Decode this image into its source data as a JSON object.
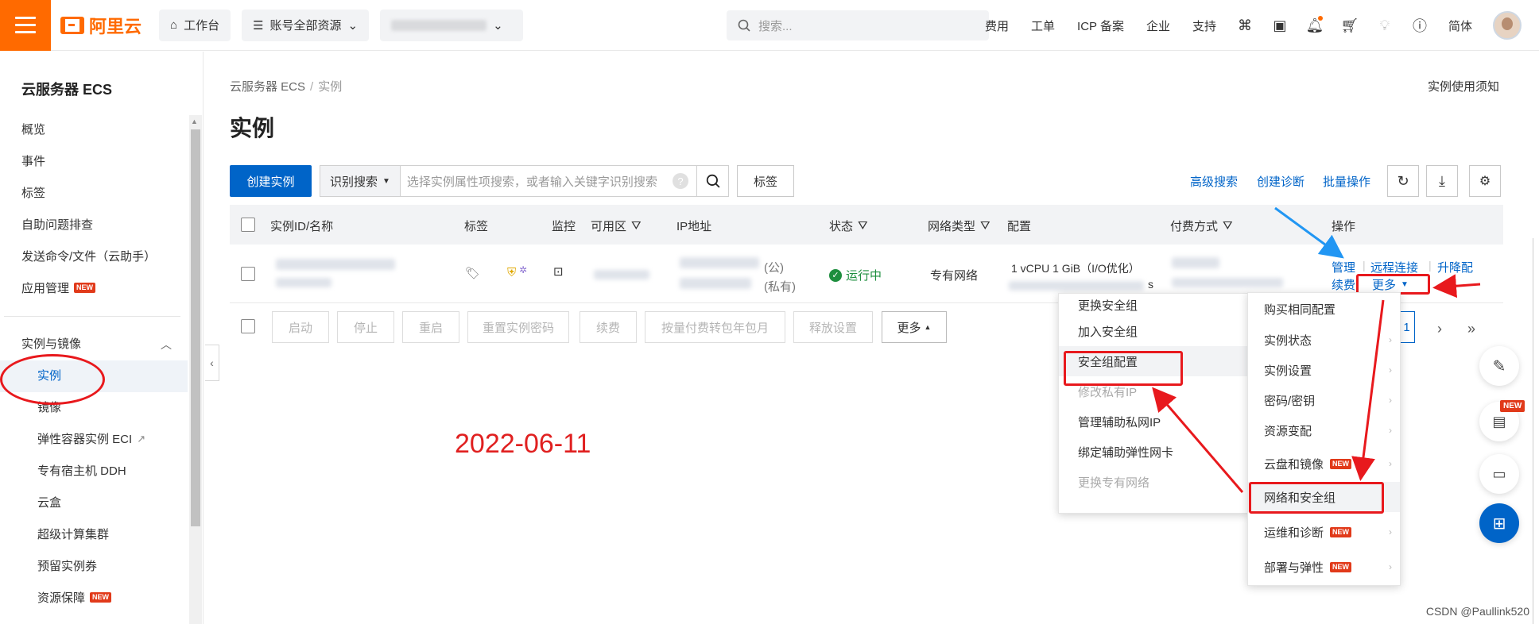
{
  "topbar": {
    "logo_text": "阿里云",
    "workbench": "工作台",
    "resources": "账号全部资源",
    "search_placeholder": "搜索...",
    "links": [
      "费用",
      "工单",
      "ICP 备案",
      "企业",
      "支持"
    ],
    "lang": "简体"
  },
  "sidebar": {
    "title": "云服务器 ECS",
    "items": [
      "概览",
      "事件",
      "标签",
      "自助问题排查",
      "发送命令/文件（云助手）",
      "应用管理"
    ],
    "group": "实例与镜像",
    "sub_items": [
      "实例",
      "镜像",
      "弹性容器实例 ECI",
      "专有宿主机 DDH",
      "云盒",
      "超级计算集群",
      "预留实例券",
      "资源保障"
    ],
    "new_label": "NEW"
  },
  "breadcrumb": {
    "root": "云服务器 ECS",
    "sep": "/",
    "current": "实例"
  },
  "notice": "实例使用须知",
  "page_title": "实例",
  "toolbar": {
    "create": "创建实例",
    "filter_select": "识别搜索",
    "filter_placeholder": "选择实例属性项搜索，或者输入关键字识别搜索",
    "tag_btn": "标签",
    "advanced": "高级搜索",
    "diagnose": "创建诊断",
    "batch": "批量操作"
  },
  "table": {
    "headers": [
      "实例ID/名称",
      "标签",
      "监控",
      "可用区",
      "IP地址",
      "状态",
      "网络类型",
      "配置",
      "付费方式",
      "操作"
    ],
    "row": {
      "ip_pub": "(公)",
      "ip_priv": "(私有)",
      "status": "运行中",
      "network": "专有网络",
      "config": "1 vCPU 1 GiB（I/O优化）",
      "config_suffix": "s",
      "ops": [
        "管理",
        "远程连接",
        "升降配",
        "续费",
        "更多"
      ]
    }
  },
  "batch_bar": {
    "buttons": [
      "启动",
      "停止",
      "重启",
      "重置实例密码",
      "续费",
      "按量付费转包年包月",
      "释放设置"
    ],
    "more": "更多",
    "page": "1"
  },
  "date_stamp": "2022-06-11",
  "submenu_left": [
    "更换安全组",
    "加入安全组",
    "安全组配置",
    "修改私有IP",
    "管理辅助私网IP",
    "绑定辅助弹性网卡",
    "更换专有网络"
  ],
  "submenu_right": [
    "购买相同配置",
    "实例状态",
    "实例设置",
    "密码/密钥",
    "资源变配",
    "云盘和镜像",
    "网络和安全组",
    "运维和诊断",
    "部署与弹性"
  ],
  "float_new": "NEW",
  "watermark": "CSDN @Paullink520",
  "colors": {
    "brand": "#ff6a00",
    "primary": "#0064c8",
    "annotation": "#e8191d",
    "success": "#1e8e3e"
  }
}
